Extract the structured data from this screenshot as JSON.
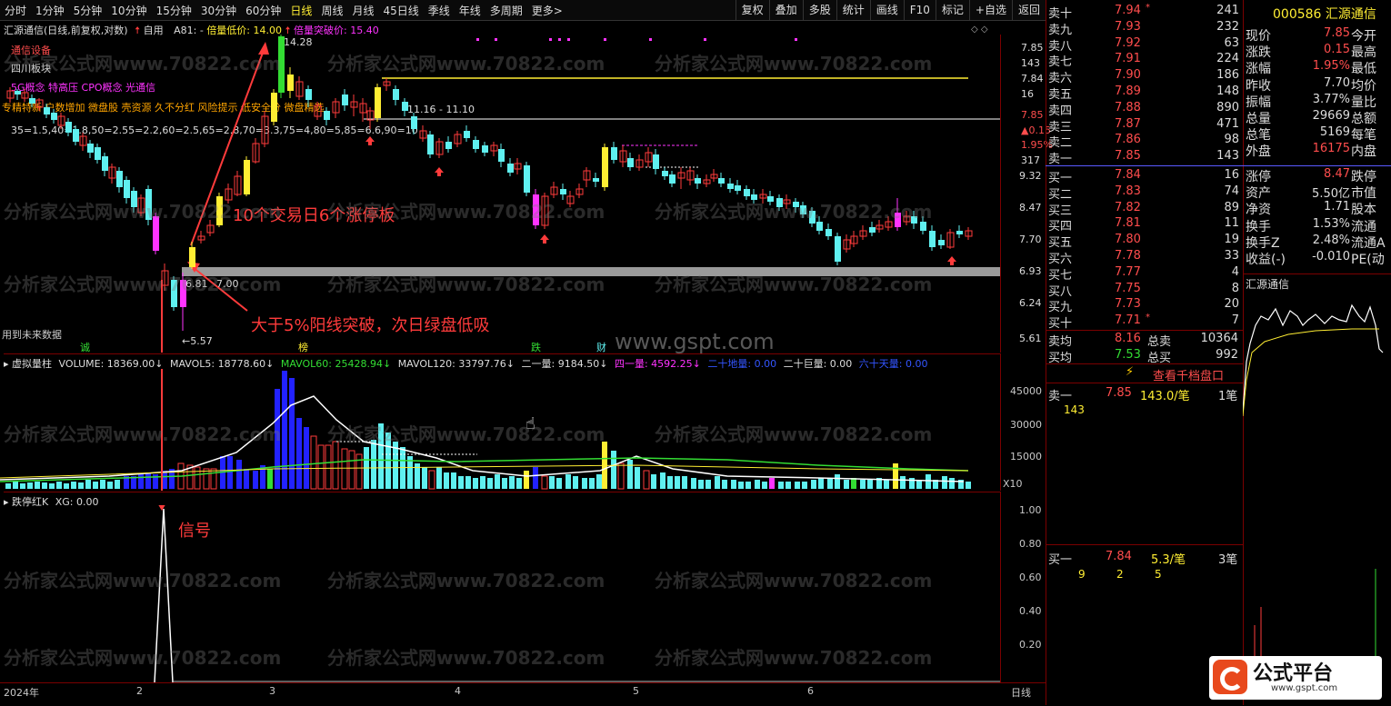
{
  "toolbar": {
    "periods": [
      "分时",
      "1分钟",
      "5分钟",
      "10分钟",
      "15分钟",
      "30分钟",
      "60分钟",
      "日线",
      "周线",
      "月线",
      "45日线",
      "季线",
      "年线",
      "多周期",
      "更多>"
    ],
    "right": [
      "复权",
      "叠加",
      "多股",
      "统计",
      "画线",
      "F10",
      "标记",
      "+自选",
      "返回"
    ]
  },
  "chart_header": {
    "title": "汇源通信(日线,前复权,对数)",
    "formula": "自用",
    "a81": "A81: -",
    "beilang_label": "倍量低价: 14.00",
    "breakout_label": "倍量突破价: 15.40"
  },
  "concepts": {
    "industry": "通信设备",
    "region": "四川板块",
    "concept_line": "5G概念 特高压 CPO概念 光通信",
    "tags_line": "专精特新 户数增加 微盘股 壳资源 久不分红 风险提示 低安全分 微盘精选",
    "ratio_line": "35=1.5,40=1.8,50=2.55=2.2,60=2.5,65=2.8,70=3.3,75=4,80=5,85=6.6,90=10"
  },
  "price_axis": {
    "labels": [
      "7.85",
      "143",
      "7.84",
      "16",
      "7.85",
      "▲0.15",
      "1.95%",
      "317",
      "9.32",
      "8.47",
      "7.70",
      "6.93",
      "6.24",
      "5.61"
    ]
  },
  "annotations": {
    "price_1428": "14.28",
    "range_label": "11.16 - 11.10",
    "low_label_1": "6.81",
    "low_label_2": "7.00",
    "low_label_3": "←5.57",
    "callout_1": "10个交易日6个涨停板",
    "callout_2": "大于5%阳线突破，次日绿盘低吸",
    "future_data": "用到未来数据",
    "signal": "信号",
    "markers": [
      "诚",
      "榜",
      "跌",
      "财"
    ],
    "watermark_site": "www.gspt.com"
  },
  "volume_header": {
    "name": "虚拟量柱",
    "volume": "VOLUME: 18369.00↓",
    "mavol5": "MAVOL5: 18778.60↓",
    "mavol60": "MAVOL60: 25428.94↓",
    "mavol120": "MAVOL120: 33797.76↓",
    "erliang": "二一量: 9184.50↓",
    "siliang": "四一量: 4592.25↓",
    "ershi_di": "二十地量: 0.00",
    "ershi_ju": "二十巨量: 0.00",
    "liushi": "六十天量: 0.00"
  },
  "volume_axis": {
    "labels": [
      "45000",
      "30000",
      "15000"
    ],
    "unit": "X10"
  },
  "signal_header": {
    "name": "跌停红K",
    "value": "XG: 0.00"
  },
  "signal_axis": {
    "labels": [
      "1.00",
      "0.80",
      "0.60",
      "0.40",
      "0.20"
    ]
  },
  "date_axis": {
    "labels": [
      "2024年",
      "2",
      "3",
      "4",
      "5",
      "6"
    ],
    "period": "日线"
  },
  "quote": {
    "sell": [
      {
        "label": "卖十",
        "price": "7.94",
        "vol": "241",
        "flag": "*"
      },
      {
        "label": "卖九",
        "price": "7.93",
        "vol": "232"
      },
      {
        "label": "卖八",
        "price": "7.92",
        "vol": "63"
      },
      {
        "label": "卖七",
        "price": "7.91",
        "vol": "224"
      },
      {
        "label": "卖六",
        "price": "7.90",
        "vol": "186"
      },
      {
        "label": "卖五",
        "price": "7.89",
        "vol": "148"
      },
      {
        "label": "卖四",
        "price": "7.88",
        "vol": "890"
      },
      {
        "label": "卖三",
        "price": "7.87",
        "vol": "471"
      },
      {
        "label": "卖二",
        "price": "7.86",
        "vol": "98"
      },
      {
        "label": "卖一",
        "price": "7.85",
        "vol": "143"
      }
    ],
    "buy": [
      {
        "label": "买一",
        "price": "7.84",
        "vol": "16"
      },
      {
        "label": "买二",
        "price": "7.83",
        "vol": "74"
      },
      {
        "label": "买三",
        "price": "7.82",
        "vol": "89"
      },
      {
        "label": "买四",
        "price": "7.81",
        "vol": "11"
      },
      {
        "label": "买五",
        "price": "7.80",
        "vol": "19"
      },
      {
        "label": "买六",
        "price": "7.78",
        "vol": "33"
      },
      {
        "label": "买七",
        "price": "7.77",
        "vol": "4"
      },
      {
        "label": "买八",
        "price": "7.75",
        "vol": "8"
      },
      {
        "label": "买九",
        "price": "7.73",
        "vol": "20"
      },
      {
        "label": "买十",
        "price": "7.71",
        "vol": "7",
        "flag": "*"
      }
    ],
    "avg_sell_label": "卖均",
    "avg_sell": "8.16",
    "total_sell_label": "总卖",
    "total_sell": "10364",
    "avg_buy_label": "买均",
    "avg_buy": "7.53",
    "total_buy_label": "总买",
    "total_buy": "992",
    "view_depth": "查看千档盘口",
    "sell1_label": "卖一",
    "sell1_price": "7.85",
    "sell1_detail": "143.0/笔",
    "sell1_count": "1笔",
    "sell1_q": "143",
    "buy1_label": "买一",
    "buy1_price": "7.84",
    "buy1_detail": "5.3/笔",
    "buy1_count": "3笔",
    "buy1_q": [
      "9",
      "2",
      "5"
    ]
  },
  "stock": {
    "code": "000586",
    "name": "汇源通信",
    "stats": [
      {
        "l": "现价",
        "v": "7.85",
        "c": "#ff4d4d",
        "r": "今开"
      },
      {
        "l": "涨跌",
        "v": "0.15",
        "c": "#ff4d4d",
        "r": "最高"
      },
      {
        "l": "涨幅",
        "v": "1.95%",
        "c": "#ff4d4d",
        "r": "最低"
      },
      {
        "l": "昨收",
        "v": "7.70",
        "c": "#ddd",
        "r": "均价"
      },
      {
        "l": "振幅",
        "v": "3.77%",
        "c": "#ddd",
        "r": "量比"
      },
      {
        "l": "总量",
        "v": "29669",
        "c": "#ddd",
        "r": "总额"
      },
      {
        "l": "总笔",
        "v": "5169",
        "c": "#ddd",
        "r": "每笔"
      },
      {
        "l": "外盘",
        "v": "16175",
        "c": "#ff4d4d",
        "r": "内盘"
      },
      {
        "l": "涨停",
        "v": "8.47",
        "c": "#ff4d4d",
        "r": "跌停"
      },
      {
        "l": "资产",
        "v": "5.50亿",
        "c": "#ddd",
        "r": "市值"
      },
      {
        "l": "净资",
        "v": "1.71",
        "c": "#ddd",
        "r": "股本"
      },
      {
        "l": "换手",
        "v": "1.53%",
        "c": "#ddd",
        "r": "流通"
      },
      {
        "l": "换手Z",
        "v": "2.48%",
        "c": "#ddd",
        "r": "流通A"
      },
      {
        "l": "收益(-)",
        "v": "-0.010",
        "c": "#ddd",
        "r": "PE(动"
      }
    ],
    "mini_title": "汇源通信"
  },
  "logo": {
    "text": "公式平台",
    "url": "www.gspt.com"
  },
  "watermark": "分析家公式网www.70822.com",
  "colors": {
    "up": "#ff3b3b",
    "down": "#5ff0f0",
    "limit": "#ffee33",
    "magenta": "#ff33ff",
    "axis_red": "#7a0000"
  }
}
